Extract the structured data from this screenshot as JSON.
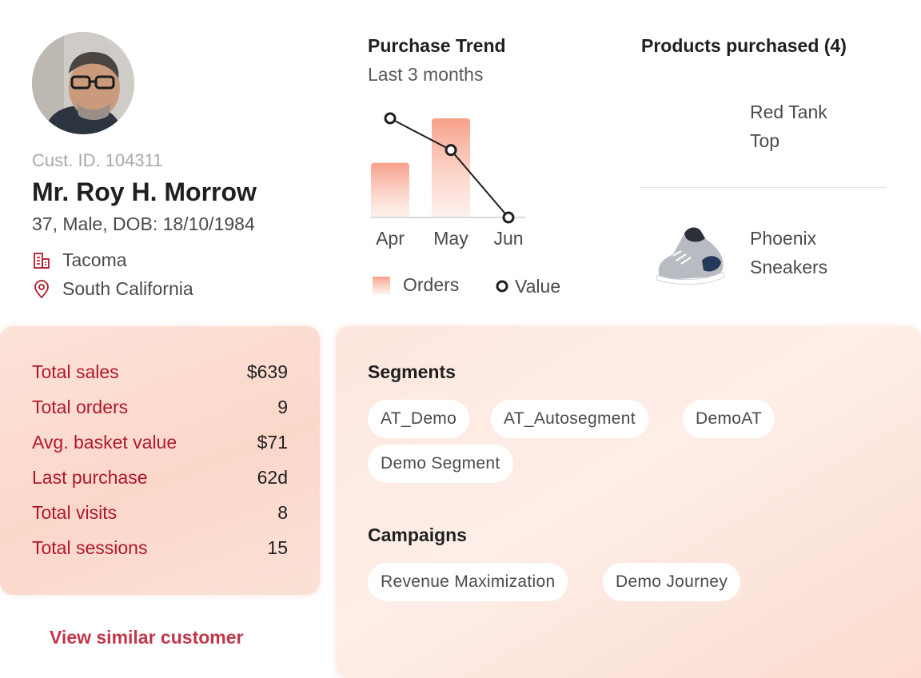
{
  "profile": {
    "cust_id": "Cust. ID. 104311",
    "name": "Mr. Roy H. Morrow",
    "meta": "37, Male, DOB: 18/10/1984",
    "city": "Tacoma",
    "region": "South California"
  },
  "trend": {
    "title": "Purchase Trend",
    "subtitle": "Last 3 months",
    "legend_orders": "Orders",
    "legend_value": "Value"
  },
  "chart_data": {
    "type": "bar",
    "title": "Purchase Trend",
    "subtitle": "Last 3 months",
    "categories": [
      "Apr",
      "May",
      "Jun"
    ],
    "series": [
      {
        "name": "Orders",
        "type": "bar",
        "values": [
          0.55,
          1.0,
          0
        ]
      },
      {
        "name": "Value",
        "type": "line",
        "values": [
          1.0,
          0.68,
          0
        ]
      }
    ],
    "grid": false,
    "legend": "bottom"
  },
  "products": {
    "title": "Products purchased (4)",
    "items": [
      {
        "name_line1": "Red Tank",
        "name_line2": "Top"
      },
      {
        "name_line1": "Phoenix",
        "name_line2": "Sneakers"
      }
    ]
  },
  "stats": {
    "rows": [
      {
        "label": "Total sales",
        "value": "$639"
      },
      {
        "label": "Total orders",
        "value": "9"
      },
      {
        "label": "Avg. basket value",
        "value": "$71"
      },
      {
        "label": "Last purchase",
        "value": "62d"
      },
      {
        "label": "Total visits",
        "value": "8"
      },
      {
        "label": "Total sessions",
        "value": "15"
      }
    ]
  },
  "similar_link": "View similar customer",
  "segments": {
    "title": "Segments",
    "chips": [
      "AT_Demo",
      "AT_Autosegment",
      "DemoAT",
      "Demo Segment"
    ]
  },
  "campaigns": {
    "title": "Campaigns",
    "chips": [
      "Revenue Maximization",
      "Demo Journey"
    ]
  },
  "colors": {
    "accent_red": "#b0182a",
    "link_red": "#c0364a",
    "bar_top": "#f7a08a",
    "card_bg": "#fbd7ca"
  },
  "icons": {
    "city": "building-icon",
    "region": "location-pin-icon"
  }
}
